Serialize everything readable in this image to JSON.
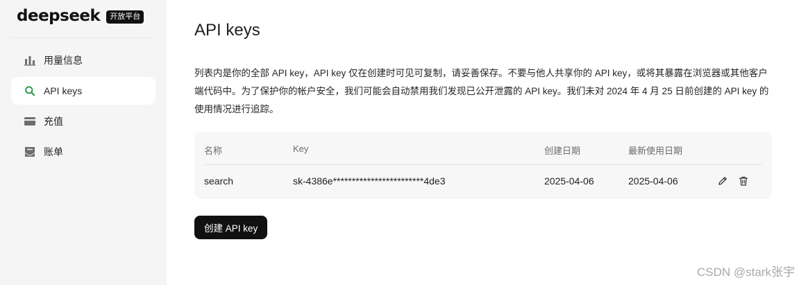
{
  "app": {
    "logo": "deepseek",
    "badge": "开放平台"
  },
  "sidebar": {
    "items": [
      {
        "label": "用量信息",
        "icon": "bar-chart-icon",
        "active": false
      },
      {
        "label": "API keys",
        "icon": "search-icon",
        "active": true
      },
      {
        "label": "充值",
        "icon": "wallet-icon",
        "active": false
      },
      {
        "label": "账单",
        "icon": "bill-icon",
        "active": false
      }
    ]
  },
  "main": {
    "title": "API keys",
    "description": "列表内是你的全部 API key，API key 仅在创建时可见可复制，请妥善保存。不要与他人共享你的 API key，或将其暴露在浏览器或其他客户端代码中。为了保护你的帐户安全，我们可能会自动禁用我们发现已公开泄露的 API key。我们未对 2024 年 4 月 25 日前创建的 API key 的使用情况进行追踪。",
    "table": {
      "columns": [
        "名称",
        "Key",
        "创建日期",
        "最新使用日期"
      ],
      "rows": [
        {
          "name": "search",
          "key": "sk-4386e************************4de3",
          "created": "2025-04-06",
          "last_used": "2025-04-06"
        }
      ]
    },
    "create_button": "创建 API key"
  },
  "watermark": "CSDN @stark张宇",
  "colors": {
    "sidebar_bg": "#f5f5f5",
    "active_item_bg": "#ffffff",
    "table_bg": "#f7f7f7",
    "button_bg": "#111111",
    "active_icon": "#2e9d4f"
  }
}
